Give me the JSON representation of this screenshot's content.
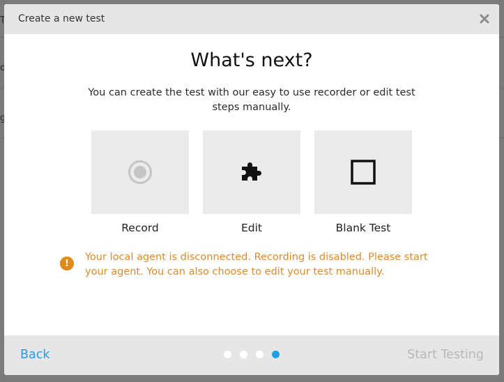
{
  "background": {
    "fragments": [
      "T",
      "o",
      "g"
    ]
  },
  "modal": {
    "title": "Create a new test",
    "close_icon": "close-icon",
    "heading": "What's next?",
    "subtitle": "You can create the test with our easy to use recorder or edit test steps manually.",
    "options": [
      {
        "label": "Record",
        "icon": "record-icon",
        "disabled": true
      },
      {
        "label": "Edit",
        "icon": "puzzle-piece-icon",
        "disabled": false
      },
      {
        "label": "Blank Test",
        "icon": "blank-square-icon",
        "disabled": false
      }
    ],
    "warning": {
      "icon": "warning-icon",
      "symbol": "!",
      "text": "Your local agent is disconnected. Recording is disabled. Please start your agent. You can also choose to edit your test manually."
    },
    "footer": {
      "back_label": "Back",
      "start_label": "Start Testing",
      "pager": {
        "total": 4,
        "current": 4
      }
    }
  },
  "colors": {
    "accent": "#2d9be0",
    "warning": "#de8a2a",
    "active_dot": "#1ea0e6"
  }
}
